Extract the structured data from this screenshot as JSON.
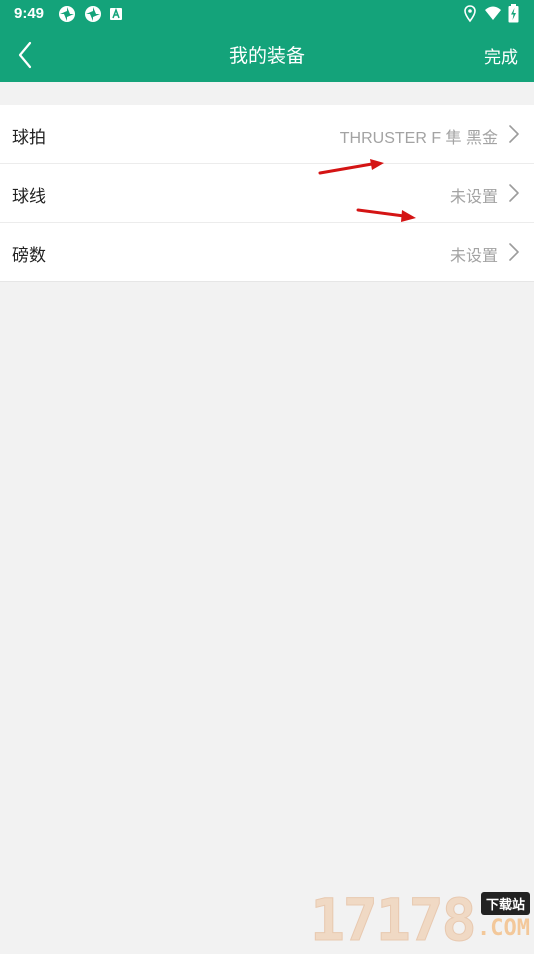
{
  "status_bar": {
    "time": "9:49",
    "icons": [
      "aperture-icon",
      "aperture-icon",
      "a-notification-icon",
      "location-icon",
      "wifi-icon",
      "battery-charging-icon"
    ]
  },
  "app_bar": {
    "back_icon": "chevron-left-icon",
    "title": "我的装备",
    "done_label": "完成"
  },
  "equipment_list": [
    {
      "label": "球拍",
      "value": "THRUSTER F 隼 黑金"
    },
    {
      "label": "球线",
      "value": "未设置"
    },
    {
      "label": "磅数",
      "value": "未设置"
    }
  ],
  "watermark": {
    "number": "17178",
    "badge": "下载站",
    "domain": ".COM"
  },
  "colors": {
    "primary": "#14a37a",
    "background": "#f2f2f2",
    "secondary_text": "#a3a3a3",
    "annotation": "#e01b1b"
  }
}
